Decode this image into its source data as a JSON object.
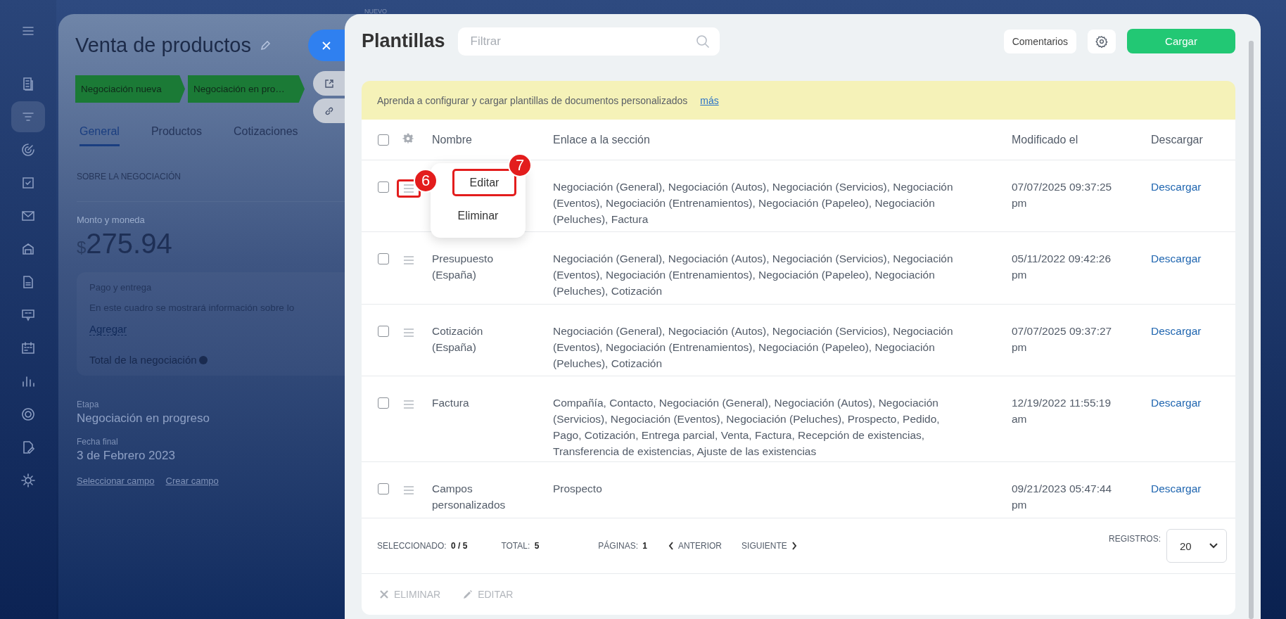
{
  "sidebar": [
    {
      "selected": false
    },
    {
      "selected": false
    },
    {
      "selected": true
    },
    {
      "selected": false
    },
    {
      "selected": false
    },
    {
      "selected": false
    },
    {
      "selected": false
    },
    {
      "selected": false
    },
    {
      "selected": false
    },
    {
      "selected": false
    },
    {
      "selected": false
    },
    {
      "selected": false
    },
    {
      "selected": false
    },
    {
      "selected": false
    }
  ],
  "deal": {
    "badge": "NUEVO",
    "title": "Venta de productos",
    "stages": [
      {
        "label": "Negociación nueva"
      },
      {
        "label": "Negociación en pro…"
      }
    ],
    "tabs": [
      {
        "label": "General",
        "selected": true
      },
      {
        "label": "Productos",
        "selected": false
      },
      {
        "label": "Cotizaciones",
        "selected": false
      }
    ],
    "section_title": "SOBRE LA NEGOCIACIÓN",
    "amount_label": "Monto y moneda",
    "currency": "$",
    "amount": "275.94",
    "payment": {
      "title": "Pago y entrega",
      "text": "En este cuadro se mostrará información sobre lo",
      "link": "Agregar"
    },
    "total_label": "Total de la negociación",
    "fields": [
      {
        "label": "Etapa",
        "value": "Negociación en progreso"
      },
      {
        "label": "Fecha final",
        "value": "3 de Febrero 2023"
      }
    ],
    "links": [
      "Seleccionar campo",
      "Crear campo"
    ]
  },
  "panel": {
    "title": "Plantillas",
    "search": {
      "placeholder": "Filtrar"
    },
    "feedback_button": "Comentarios",
    "upload_button": "Cargar",
    "banner": {
      "text": "Aprenda a configurar y cargar plantillas de documentos personalizados",
      "link": "más"
    },
    "table": {
      "all_checked": false,
      "columns": [
        "Nombre",
        "Enlace a la sección",
        "Modificado el",
        "Descargar"
      ],
      "rows": [
        {
          "checked": false,
          "name": "",
          "sections": "Negociación (General), Negociación (Autos), Negociación (Servicios), Negociación (Eventos), Negociación (Entrenamientos), Negociación (Papeleo), Negociación (Peluches), Factura",
          "modified": "07/07/2025 09:37:25 pm",
          "download": "Descargar",
          "menu_open": true
        },
        {
          "checked": false,
          "name": "Presupuesto (España)",
          "sections": "Negociación (General), Negociación (Autos), Negociación (Servicios), Negociación (Eventos), Negociación (Entrenamientos), Negociación (Papeleo), Negociación (Peluches), Cotización",
          "modified": "05/11/2022 09:42:26 pm",
          "download": "Descargar",
          "menu_open": false
        },
        {
          "checked": false,
          "name": "Cotización (España)",
          "sections": "Negociación (General), Negociación (Autos), Negociación (Servicios), Negociación (Eventos), Negociación (Entrenamientos), Negociación (Papeleo), Negociación (Peluches), Cotización",
          "modified": "07/07/2025 09:37:27 pm",
          "download": "Descargar",
          "menu_open": false
        },
        {
          "checked": false,
          "name": "Factura",
          "sections": "Compañía, Contacto, Negociación (General), Negociación (Autos), Negociación (Servicios), Negociación (Eventos), Negociación (Peluches), Prospecto, Pedido, Pago, Cotización, Entrega parcial, Venta, Factura, Recepción de existencias, Transferencia de existencias, Ajuste de las existencias",
          "modified": "12/19/2022 11:55:19 am",
          "download": "Descargar",
          "menu_open": false
        },
        {
          "checked": false,
          "name": "Campos personalizados",
          "sections": "Prospecto",
          "modified": "09/21/2023 05:47:44 pm",
          "download": "Descargar",
          "menu_open": false
        }
      ]
    },
    "row_menu": [
      {
        "label": "Editar",
        "marker": "7"
      },
      {
        "label": "Eliminar"
      }
    ],
    "handle_marker": "6",
    "footer": {
      "selected_label": "SELECCIONADO:",
      "selected_value": "0 / 5",
      "total_label": "TOTAL:",
      "total_value": "5",
      "pages_label": "PÁGINAS:",
      "pages_value": "1",
      "prev": "ANTERIOR",
      "next": "SIGUIENTE",
      "records_label": "REGISTROS:",
      "records_value": "20"
    },
    "actions": [
      {
        "kind": "delete",
        "label": "ELIMINAR",
        "disabled": true
      },
      {
        "kind": "edit",
        "label": "EDITAR",
        "disabled": true
      }
    ]
  }
}
